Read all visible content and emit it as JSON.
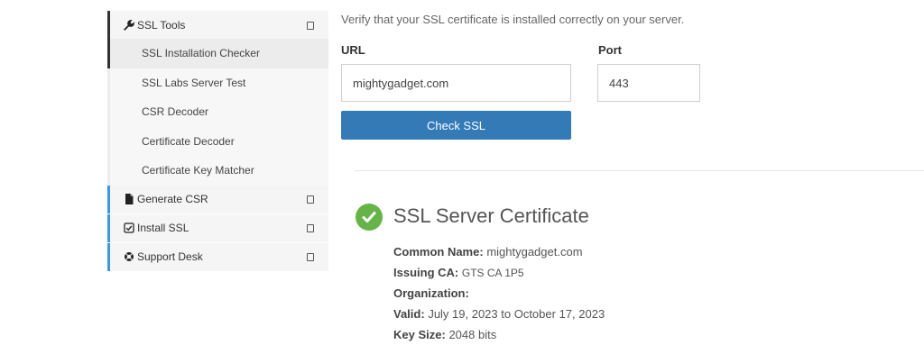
{
  "sidebar": {
    "ssl_tools": {
      "label": "SSL Tools",
      "items": [
        {
          "label": "SSL Installation Checker"
        },
        {
          "label": "SSL Labs Server Test"
        },
        {
          "label": "CSR Decoder"
        },
        {
          "label": "Certificate Decoder"
        },
        {
          "label": "Certificate Key Matcher"
        }
      ]
    },
    "generate_csr": {
      "label": "Generate CSR"
    },
    "install_ssl": {
      "label": "Install SSL"
    },
    "support_desk": {
      "label": "Support Desk"
    }
  },
  "form": {
    "intro": "Verify that your SSL certificate is installed correctly on your server.",
    "url_label": "URL",
    "url_value": "mightygadget.com",
    "port_label": "Port",
    "port_value": "443",
    "submit_label": "Check SSL"
  },
  "result": {
    "title": "SSL Server Certificate",
    "common_name_label": "Common Name:",
    "common_name_value": "mightygadget.com",
    "issuing_ca_label": "Issuing CA:",
    "issuing_ca_value": "GTS CA 1P5",
    "organization_label": "Organization:",
    "organization_value": "",
    "valid_label": "Valid:",
    "valid_value": "July 19, 2023 to October 17, 2023",
    "key_size_label": "Key Size:",
    "key_size_value": "2048 bits"
  },
  "icons": {
    "ssl_tools": "wrench-icon",
    "generate_csr": "file-icon",
    "install_ssl": "checkbox-icon",
    "support_desk": "lifebuoy-icon",
    "status": "check-circle-icon"
  },
  "colors": {
    "accent_blue": "#3a99d8",
    "button": "#337ab7",
    "success": "#66b447"
  }
}
